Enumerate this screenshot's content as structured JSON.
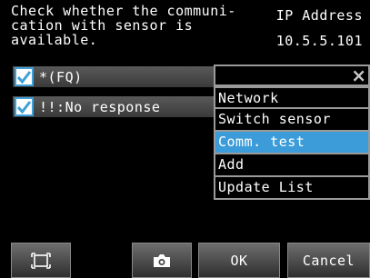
{
  "header": {
    "message": "Check whether the communi-\ncation with sensor is\navailable.",
    "ip_label": "IP Address",
    "ip_value": "10.5.5.101"
  },
  "list": {
    "items": [
      {
        "label": "*(FQ)",
        "checked": true
      },
      {
        "label": "!!:No response",
        "checked": true
      }
    ]
  },
  "menu": {
    "close_glyph": "×",
    "items": [
      {
        "label": "Network",
        "selected": false
      },
      {
        "label": "Switch sensor",
        "selected": false
      },
      {
        "label": "Comm. test",
        "selected": true
      },
      {
        "label": "Add",
        "selected": false
      },
      {
        "label": "Update List",
        "selected": false
      }
    ]
  },
  "toolbar": {
    "frame_icon": "frame-icon",
    "camera_icon": "camera-icon",
    "ok_label": "OK",
    "cancel_label": "Cancel"
  },
  "colors": {
    "selected": "#3c9cd9",
    "check_border": "#3ea0d8",
    "background": "#000000"
  }
}
